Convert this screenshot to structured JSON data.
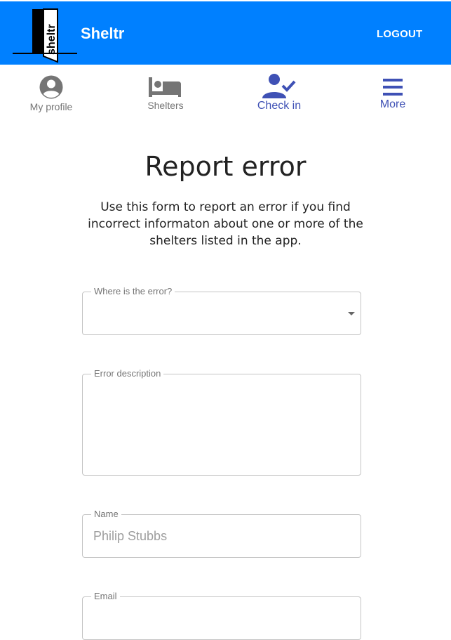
{
  "header": {
    "logo_text": "sheltr",
    "brand": "Sheltr",
    "logout_label": "LOGOUT"
  },
  "nav": {
    "items": [
      {
        "label": "My profile",
        "icon": "account-circle-icon",
        "active": false
      },
      {
        "label": "Shelters",
        "icon": "bed-icon",
        "active": false
      },
      {
        "label": "Check in",
        "icon": "person-check-icon",
        "active": true
      },
      {
        "label": "More",
        "icon": "menu-icon",
        "active": true
      }
    ]
  },
  "page": {
    "title": "Report error",
    "intro": "Use this form to report an error if you find incorrect informaton about one or more of the shelters listed in the app."
  },
  "form": {
    "where": {
      "label": "Where is the error?",
      "value": ""
    },
    "description": {
      "label": "Error description",
      "value": ""
    },
    "name": {
      "label": "Name",
      "value": "Philip Stubbs"
    },
    "email": {
      "label": "Email"
    }
  },
  "colors": {
    "header_bg": "#0080ff",
    "active_nav": "#3f51b5",
    "inactive_nav": "#757575"
  }
}
